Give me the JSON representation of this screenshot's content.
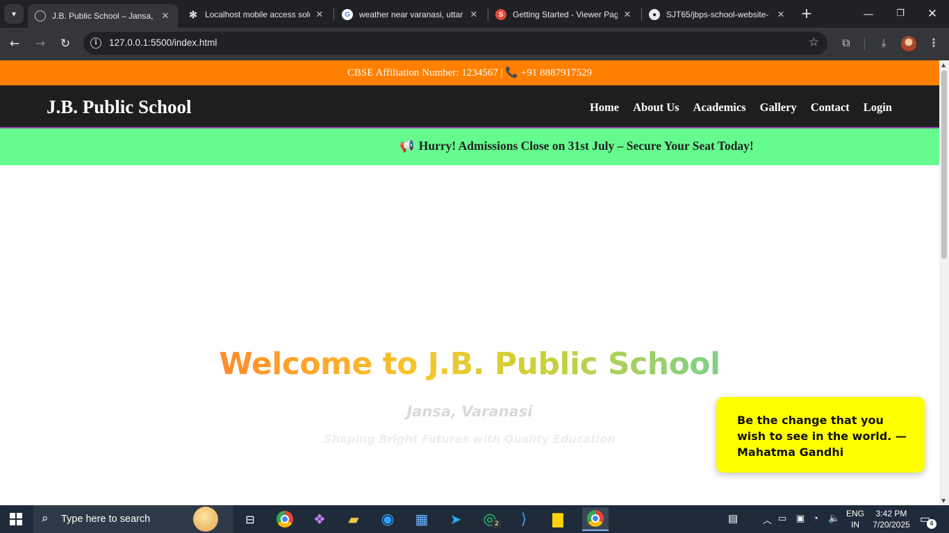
{
  "browser": {
    "tabs": [
      {
        "title": "J.B. Public School – Jansa, Va",
        "icon": "globe-icon",
        "active": true
      },
      {
        "title": "Localhost mobile access solu",
        "icon": "openai-icon",
        "active": false
      },
      {
        "title": "weather near varanasi, uttar",
        "icon": "google-icon",
        "active": false
      },
      {
        "title": "Getting Started - Viewer Pag",
        "icon": "s-icon",
        "active": false
      },
      {
        "title": "SJT65/jbps-school-website-",
        "icon": "github-icon",
        "active": false
      }
    ],
    "url": "127.0.0.1:5500/index.html"
  },
  "page": {
    "topbar": {
      "affiliation": "CBSE Affiliation Number: 1234567 |",
      "phone": "+91 8887917529"
    },
    "header": {
      "brand": "J.B. Public School",
      "nav": [
        "Home",
        "About Us",
        "Academics",
        "Gallery",
        "Contact",
        "Login"
      ]
    },
    "ticker": {
      "message": "Hurry! Admissions Close on 31st July – Secure Your Seat Today!"
    },
    "hero": {
      "title": "Welcome to J.B. Public School",
      "subtitle": "Jansa, Varanasi",
      "tagline": "Shaping Bright Futures with Quality Education"
    },
    "quote": {
      "text": "Be the change that you wish to see in the world. — Mahatma Gandhi"
    }
  },
  "taskbar": {
    "search_placeholder": "Type here to search",
    "whatsapp_badge": "2",
    "lang_top": "ENG",
    "lang_bottom": "IN",
    "time": "3:42 PM",
    "date": "7/20/2025",
    "notification_count": "4"
  },
  "colors": {
    "topbar": "#ff7f00",
    "header": "#1e1e1e",
    "ticker": "#66fb8e",
    "quote_card": "#ffff00"
  }
}
